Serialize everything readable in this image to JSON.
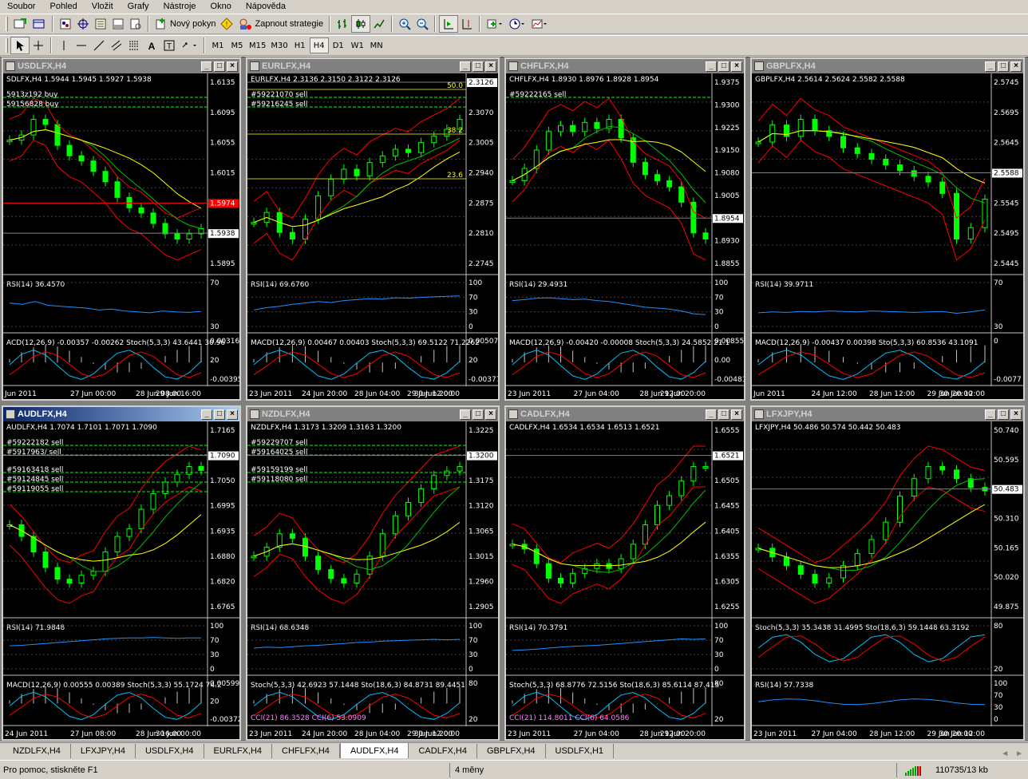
{
  "menu": [
    "Soubor",
    "Pohled",
    "Vložit",
    "Grafy",
    "Nástroje",
    "Okno",
    "Nápověda"
  ],
  "toolbar": {
    "new_order_label": "Nový pokyn",
    "strategy_label": "Zapnout strategie"
  },
  "timeframes": [
    "M1",
    "M5",
    "M15",
    "M30",
    "H1",
    "H4",
    "D1",
    "W1",
    "MN"
  ],
  "active_timeframe": "H4",
  "charts": [
    {
      "title": "USDLFX,H4",
      "active": false,
      "ohlc": "SDLFX,H4  1.5944 1.5945 1.5927 1.5938",
      "price_ticks": [
        "1.6135",
        "1.6095",
        "1.6055",
        "1.6015",
        "1.5974",
        "1.5938",
        "1.5895"
      ],
      "current_price": "1.5938",
      "alert_price": "1.5974",
      "orders": [
        "5913z192 buy",
        "59156828 buy"
      ],
      "fib_levels": [],
      "series": [
        1.611,
        1.612,
        1.615,
        1.614,
        1.61,
        1.608,
        1.607,
        1.605,
        1.603,
        1.6,
        1.598,
        1.597,
        1.595,
        1.593,
        1.592,
        1.593,
        1.594
      ],
      "pane1": {
        "label": "RSI(14) 36.4570",
        "ticks": [
          "70",
          "30"
        ],
        "series": [
          55,
          52,
          58,
          50,
          48,
          46,
          44,
          40,
          42,
          38,
          36,
          34,
          38,
          36,
          35,
          37
        ]
      },
      "pane2": {
        "label": "ACD(12,26,9) -0.00357 -0.00262  Stoch(5,3,3) 43.6441 30.96",
        "ticks": [
          "0.00316",
          "20",
          "-0.00395"
        ]
      },
      "time_ticks": [
        "Jun 2011",
        "27 Jun 00:00",
        "28 Jun 08:00",
        "29 Jun 16:00"
      ]
    },
    {
      "title": "EURLFX,H4",
      "active": false,
      "ohlc": "EURLFX,H4  2.3136 2.3150 2.3122 2.3126",
      "price_ticks": [
        "2.3126",
        "2.3070",
        "2.3005",
        "2.2940",
        "2.2875",
        "2.2810",
        "2.2745"
      ],
      "current_price": "2.3126",
      "alert_price": "",
      "orders": [
        "#59221070 sell",
        "#59216245 sell"
      ],
      "fib_levels": [
        "50.0",
        "38.2",
        "23.6"
      ],
      "series": [
        2.282,
        2.285,
        2.279,
        2.277,
        2.283,
        2.29,
        2.295,
        2.298,
        2.296,
        2.3,
        2.302,
        2.304,
        2.303,
        2.306,
        2.308,
        2.31,
        2.313
      ],
      "pane1": {
        "label": "RSI(14) 69.6760",
        "ticks": [
          "100",
          "70",
          "30",
          "0"
        ],
        "series": [
          40,
          45,
          48,
          52,
          55,
          58,
          56,
          60,
          62,
          64,
          63,
          66,
          65,
          67,
          68,
          69,
          70
        ]
      },
      "pane2": {
        "label": "MACD(12,26,9) 0.00467 0.00403  Stoch(5,3,3) 69.5122 71.2262",
        "ticks": [
          "0.00507",
          "20",
          "-0.00377"
        ]
      },
      "time_ticks": [
        "23 Jun 2011",
        "24 Jun 20:00",
        "28 Jun 04:00",
        "29 Jun 12:00",
        "30 Jun 20:00"
      ]
    },
    {
      "title": "CHFLFX,H4",
      "active": false,
      "ohlc": "CHFLFX,H4  1.8930 1.8976 1.8928 1.8954",
      "price_ticks": [
        "1.9375",
        "1.9300",
        "1.9225",
        "1.9150",
        "1.9080",
        "1.9005",
        "1.8954",
        "1.8930",
        "1.8855"
      ],
      "current_price": "1.8954",
      "alert_price": "",
      "orders": [
        "#59222165 sell"
      ],
      "fib_levels": [],
      "series": [
        1.912,
        1.916,
        1.922,
        1.928,
        1.93,
        1.928,
        1.931,
        1.929,
        1.932,
        1.926,
        1.918,
        1.914,
        1.912,
        1.91,
        1.905,
        1.895,
        1.893
      ],
      "pane1": {
        "label": "RSI(14) 29.4931",
        "ticks": [
          "100",
          "70",
          "30",
          "0"
        ],
        "series": [
          60,
          62,
          65,
          66,
          64,
          62,
          63,
          60,
          58,
          54,
          50,
          46,
          44,
          42,
          38,
          32,
          30
        ]
      },
      "pane2": {
        "label": "MACD(12,26,9) -0.00420 -0.00008  Stoch(5,3,3) 24.5852 21.1",
        "ticks": [
          "0.00855",
          "0.00",
          "-0.00481"
        ]
      },
      "time_ticks": [
        "23 Jun 2011",
        "27 Jun 04:00",
        "28 Jun 12:00",
        "29 Jun 20:00"
      ]
    },
    {
      "title": "GBPLFX,H4",
      "active": false,
      "ohlc": "GBPLFX,H4  2.5614 2.5624 2.5582 2.5588",
      "price_ticks": [
        "2.5745",
        "2.5695",
        "2.5645",
        "2.5588",
        "2.5545",
        "2.5495",
        "2.5445"
      ],
      "current_price": "2.5588",
      "alert_price": "",
      "orders": [],
      "fib_levels": [],
      "series": [
        2.569,
        2.572,
        2.57,
        2.573,
        2.571,
        2.57,
        2.568,
        2.567,
        2.566,
        2.565,
        2.564,
        2.563,
        2.562,
        2.56,
        2.552,
        2.554,
        2.559
      ],
      "pane1": {
        "label": "RSI(14) 39.9711",
        "ticks": [
          "70",
          "30"
        ],
        "series": [
          34,
          36,
          35,
          37,
          36,
          38,
          37,
          36,
          38,
          37,
          36,
          35,
          36,
          37,
          33,
          36,
          40
        ]
      },
      "pane2": {
        "label": "MACD(12,26,9) -0.00437 0.00398  Sto(5,3,3) 60.8536 43.1091",
        "ticks": [
          "0",
          "-0.0077"
        ]
      },
      "time_ticks": [
        "Jun 2011",
        "24 Jun 12:00",
        "28 Jun 12:00",
        "29 Jun 20:00",
        "30 Jun 12:00"
      ]
    },
    {
      "title": "AUDLFX,H4",
      "active": true,
      "ohlc": "AUDLFX,H4  1.7074 1.7101 1.7071 1.7090",
      "price_ticks": [
        "1.7165",
        "1.7090",
        "1.7050",
        "1.6995",
        "1.6935",
        "1.6880",
        "1.6820",
        "1.6765"
      ],
      "current_price": "1.7090",
      "alert_price": "",
      "orders": [
        "#59222182 sell",
        "#5917963/ sell",
        "#59163418 sell",
        "#59124845 sell",
        "#59119055 sell"
      ],
      "fib_levels": [],
      "series": [
        1.695,
        1.692,
        1.688,
        1.684,
        1.681,
        1.68,
        1.682,
        1.683,
        1.688,
        1.692,
        1.694,
        1.699,
        1.703,
        1.706,
        1.708,
        1.71,
        1.709
      ],
      "pane1": {
        "label": "RSI(14) 71.9848",
        "ticks": [
          "100",
          "70",
          "30",
          "0"
        ],
        "series": [
          55,
          56,
          58,
          60,
          62,
          64,
          66,
          68,
          70,
          71,
          72,
          72,
          73,
          72,
          71,
          72,
          72
        ]
      },
      "pane2": {
        "label": "MACD(12,26,9) 0.00555 0.00389  Stoch(5,3,3) 55.1724 74.2",
        "ticks": [
          "0.00599",
          "20",
          "-0.00372"
        ]
      },
      "time_ticks": [
        "24 Jun 2011",
        "27 Jun 08:00",
        "28 Jun 16:00",
        "30 Jun 00:00"
      ]
    },
    {
      "title": "NZDLFX,H4",
      "active": false,
      "ohlc": "NZDLFX,H4  1.3173 1.3209 1.3163 1.3200",
      "price_ticks": [
        "1.3225",
        "1.3200",
        "1.3175",
        "1.3120",
        "1.3065",
        "1.3015",
        "1.2960",
        "1.2905"
      ],
      "current_price": "1.3200",
      "alert_price": "",
      "orders": [
        "#59229707 sell",
        "#59164025 sell",
        "#59159199 sell",
        "#59118080 sell"
      ],
      "fib_levels": [],
      "series": [
        1.3,
        1.302,
        1.305,
        1.304,
        1.3,
        1.297,
        1.295,
        1.294,
        1.296,
        1.3,
        1.305,
        1.309,
        1.312,
        1.315,
        1.318,
        1.319,
        1.32
      ],
      "pane1": {
        "label": "RSI(14) 68.6348",
        "ticks": [
          "100",
          "70",
          "30",
          "0"
        ],
        "series": [
          50,
          52,
          51,
          53,
          55,
          56,
          58,
          60,
          62,
          63,
          65,
          66,
          67,
          68,
          69,
          68,
          69
        ]
      },
      "pane2": {
        "label": "Stoch(5,3,3) 42.6923 57.1448  Sto(18,6,3) 84.8731 89.4451",
        "ticks": [
          "80",
          "20"
        ]
      },
      "pane3": {
        "label": "CCI(21) 86.3528  CCI(6) 53.0909",
        "ticks": []
      },
      "time_ticks": [
        "23 Jun 2011",
        "24 Jun 20:00",
        "28 Jun 04:00",
        "29 Jun 12:00",
        "30 Jun 20:00"
      ]
    },
    {
      "title": "CADLFX,H4",
      "active": false,
      "ohlc": "CADLFX,H4  1.6534 1.6534 1.6513 1.6521",
      "price_ticks": [
        "1.6555",
        "1.6521",
        "1.6505",
        "1.6455",
        "1.6405",
        "1.6355",
        "1.6305",
        "1.6255"
      ],
      "current_price": "1.6521",
      "alert_price": "",
      "orders": [],
      "fib_levels": [],
      "series": [
        1.636,
        1.635,
        1.632,
        1.629,
        1.628,
        1.63,
        1.631,
        1.632,
        1.631,
        1.633,
        1.636,
        1.64,
        1.644,
        1.646,
        1.649,
        1.652,
        1.652
      ],
      "pane1": {
        "label": "RSI(14) 70.3791",
        "ticks": [
          "100",
          "70",
          "30",
          "0"
        ],
        "series": [
          45,
          46,
          48,
          50,
          52,
          54,
          55,
          56,
          58,
          60,
          62,
          64,
          66,
          68,
          70,
          69,
          70
        ]
      },
      "pane2": {
        "label": "Stoch(5,3,3) 68.8776 72.5156  Sto(18,6,3) 85.6114 87.415",
        "ticks": [
          "80",
          "20"
        ]
      },
      "pane3": {
        "label": "CCI(21) 114.8011  CCI(6) 64.0586",
        "ticks": []
      },
      "time_ticks": [
        "23 Jun 2011",
        "27 Jun 04:00",
        "28 Jun 12:00",
        "29 Jun 20:00"
      ]
    },
    {
      "title": "LFXJPY,H4",
      "active": false,
      "ohlc": "LFXJPY,H4  50.486 50.574 50.442 50.483",
      "price_ticks": [
        "50.740",
        "50.595",
        "50.483",
        "50.310",
        "50.165",
        "50.020",
        "49.875"
      ],
      "current_price": "50.483",
      "alert_price": "",
      "orders": [],
      "fib_levels": [],
      "series": [
        50.15,
        50.1,
        50.05,
        50.0,
        49.95,
        49.98,
        50.05,
        50.12,
        50.2,
        50.3,
        50.45,
        50.55,
        50.62,
        50.6,
        50.55,
        50.5,
        50.48
      ],
      "pane1": {
        "label": "Stoch(5,3,3) 35.3438 31.4995  Sto(18,6,3) 59.1448 63.3192",
        "ticks": [
          "80",
          "20"
        ]
      },
      "pane2": {
        "label": "RSI(14) 57.7338",
        "ticks": [
          "100",
          "70",
          "30",
          "0"
        ]
      },
      "time_ticks": [
        "23 Jun 2011",
        "27 Jun 04:00",
        "28 Jun 12:00",
        "29 Jun 20:00",
        "30 Jun 12:00"
      ]
    }
  ],
  "tabs": [
    "NZDLFX,H4",
    "LFXJPY,H4",
    "USDLFX,H4",
    "EURLFX,H4",
    "CHFLFX,H4",
    "AUDLFX,H4",
    "CADLFX,H4",
    "GBPLFX,H4",
    "USDLFX,H1"
  ],
  "active_tab": "AUDLFX,H4",
  "status": {
    "help": "Pro pomoc, stiskněte F1",
    "profile": "4 měny",
    "traffic": "110735/13 kb"
  },
  "colors": {
    "candle": "#00ff00",
    "bollinger": "#ff0000",
    "ma_fast": "#00c000",
    "ma_slow": "#ffff00",
    "rsi": "#1e90ff",
    "order_line": "#00ff00",
    "title_active": "#0a246a"
  }
}
